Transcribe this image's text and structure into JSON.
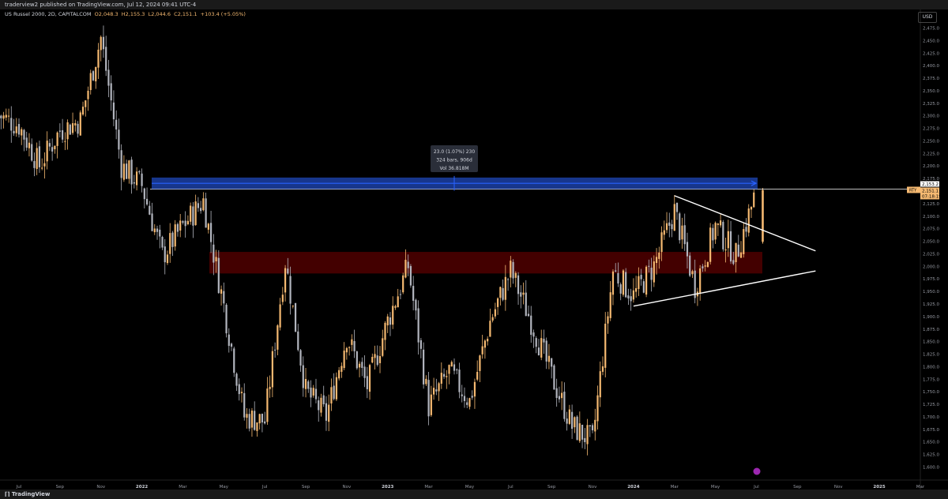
{
  "header": {
    "publish_info": "traderview2 published on TradingView.com, Jul 12, 2024 09:41 UTC-4"
  },
  "legend": {
    "title": "US Russel 2000, 2D, CAPITALCOM",
    "open": "O2,048.3",
    "high": "H2,155.3",
    "low": "L2,044.6",
    "close": "C2,151.1",
    "change": "+103.4 (+5.05%)"
  },
  "currency": "USD",
  "footer": {
    "brand": "TradingView"
  },
  "price_scale": {
    "min": 1600,
    "max": 2475,
    "step": 25,
    "labels": [
      "2,475.0",
      "2,450.0",
      "2,425.0",
      "2,400.0",
      "2,375.0",
      "2,350.0",
      "2,325.0",
      "2,300.0",
      "2,275.0",
      "2,250.0",
      "2,225.0",
      "2,200.0",
      "2,175.0",
      "2,150.0",
      "2,125.0",
      "2,100.0",
      "2,075.0",
      "2,050.0",
      "2,025.0",
      "2,000.0",
      "1,975.0",
      "1,950.0",
      "1,925.0",
      "1,900.0",
      "1,875.0",
      "1,850.0",
      "1,825.0",
      "1,800.0",
      "1,775.0",
      "1,750.0",
      "1,725.0",
      "1,700.0",
      "1,675.0",
      "1,650.0",
      "1,625.0",
      "1,600.0"
    ]
  },
  "price_tags": {
    "symbol": "RTY",
    "line_price": "2,153.2",
    "last_price": "2,151.1",
    "countdown": "07:18:19",
    "line_value": 2153.2,
    "last_value": 2151.1
  },
  "time_axis": {
    "labels": [
      "Jul",
      "Sep",
      "Nov",
      "2022",
      "Mar",
      "May",
      "Jul",
      "Sep",
      "Nov",
      "2023",
      "Mar",
      "May",
      "Jul",
      "Sep",
      "Nov",
      "2024",
      "Mar",
      "May",
      "Jul",
      "Sep",
      "Nov",
      "2025",
      "Mar"
    ],
    "bold": [
      "2022",
      "2023",
      "2024",
      "2025"
    ]
  },
  "measure_tool": {
    "line1": "23.0 (1.07%) 230",
    "line2": "324 bars, 906d",
    "line3": "Vol 36.818M",
    "price_from": 2153.2,
    "price_to": 2176.2
  },
  "support_zone": {
    "low": 1985,
    "high": 2028,
    "color": "#4a0000"
  },
  "triangle": {
    "upper": [
      {
        "month": "2024-03",
        "price": 2140
      },
      {
        "month": "2024-09",
        "price": 2030
      }
    ],
    "lower": [
      {
        "month": "2024-01",
        "price": 1920
      },
      {
        "month": "2024-09",
        "price": 1990
      }
    ]
  },
  "colors": {
    "up": "#f5b971",
    "down": "#b2b5be",
    "measure": "#2962ff",
    "zone": "#4a0000",
    "line": "#ffffff"
  },
  "chart_data": {
    "type": "candlestick",
    "title": "US Russel 2000, 2D, CAPITALCOM",
    "ylim": [
      1600,
      2475
    ],
    "price_path": [
      {
        "date": "2021-06",
        "price": 2300
      },
      {
        "date": "2021-07",
        "price": 2280
      },
      {
        "date": "2021-08",
        "price": 2200
      },
      {
        "date": "2021-09",
        "price": 2270
      },
      {
        "date": "2021-10",
        "price": 2290
      },
      {
        "date": "2021-11",
        "price": 2455
      },
      {
        "date": "2021-12",
        "price": 2200
      },
      {
        "date": "2022-01",
        "price": 2160
      },
      {
        "date": "2022-02",
        "price": 2020
      },
      {
        "date": "2022-03",
        "price": 2080
      },
      {
        "date": "2022-04",
        "price": 2130
      },
      {
        "date": "2022-05",
        "price": 1920
      },
      {
        "date": "2022-06",
        "price": 1700
      },
      {
        "date": "2022-07",
        "price": 1690
      },
      {
        "date": "2022-08",
        "price": 2010
      },
      {
        "date": "2022-09",
        "price": 1750
      },
      {
        "date": "2022-10",
        "price": 1700
      },
      {
        "date": "2022-11",
        "price": 1860
      },
      {
        "date": "2022-12",
        "price": 1760
      },
      {
        "date": "2023-01",
        "price": 1890
      },
      {
        "date": "2023-02",
        "price": 2000
      },
      {
        "date": "2023-03",
        "price": 1720
      },
      {
        "date": "2023-04",
        "price": 1790
      },
      {
        "date": "2023-05",
        "price": 1730
      },
      {
        "date": "2023-06",
        "price": 1890
      },
      {
        "date": "2023-07",
        "price": 1990
      },
      {
        "date": "2023-08",
        "price": 1890
      },
      {
        "date": "2023-09",
        "price": 1780
      },
      {
        "date": "2023-10",
        "price": 1680
      },
      {
        "date": "2023-11",
        "price": 1650
      },
      {
        "date": "2023-12",
        "price": 1990
      },
      {
        "date": "2024-01",
        "price": 1940
      },
      {
        "date": "2024-02",
        "price": 2000
      },
      {
        "date": "2024-03",
        "price": 2110
      },
      {
        "date": "2024-04",
        "price": 1960
      },
      {
        "date": "2024-05",
        "price": 2080
      },
      {
        "date": "2024-06",
        "price": 2020
      },
      {
        "date": "2024-07",
        "price": 2151
      }
    ]
  }
}
